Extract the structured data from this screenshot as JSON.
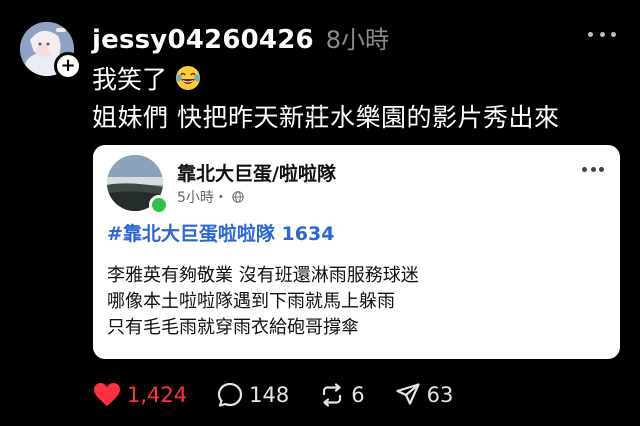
{
  "post": {
    "username": "jessy04260426",
    "timestamp": "8小時",
    "line1": "我笑了",
    "line2": "姐妹們 快把昨天新莊水樂園的影片秀出來"
  },
  "embedded": {
    "name": "靠北大巨蛋/啦啦隊",
    "time": "5小時・",
    "hashtag": "#靠北大巨蛋啦啦隊 1634",
    "body_lines": [
      "李雅英有夠敬業 沒有班還淋雨服務球迷",
      "哪像本土啦啦隊遇到下雨就馬上躲雨",
      "只有毛毛雨就穿雨衣給砲哥撐傘"
    ]
  },
  "actions": {
    "likes": "1,424",
    "comments": "148",
    "reposts": "6",
    "shares": "63"
  },
  "icons": {
    "avatar": "profile-photo",
    "follow": "plus-icon",
    "more": "more-horizontal-icon",
    "emoji": "laughing-tears-emoji",
    "globe": "globe-icon",
    "like": "heart-filled-icon",
    "comment": "speech-bubble-icon",
    "repost": "repost-arrows-icon",
    "share": "send-arrow-icon"
  },
  "colors": {
    "background": "#000000",
    "like_active": "#ff3040",
    "hashtag": "#2a66d9",
    "online": "#31c24a"
  }
}
